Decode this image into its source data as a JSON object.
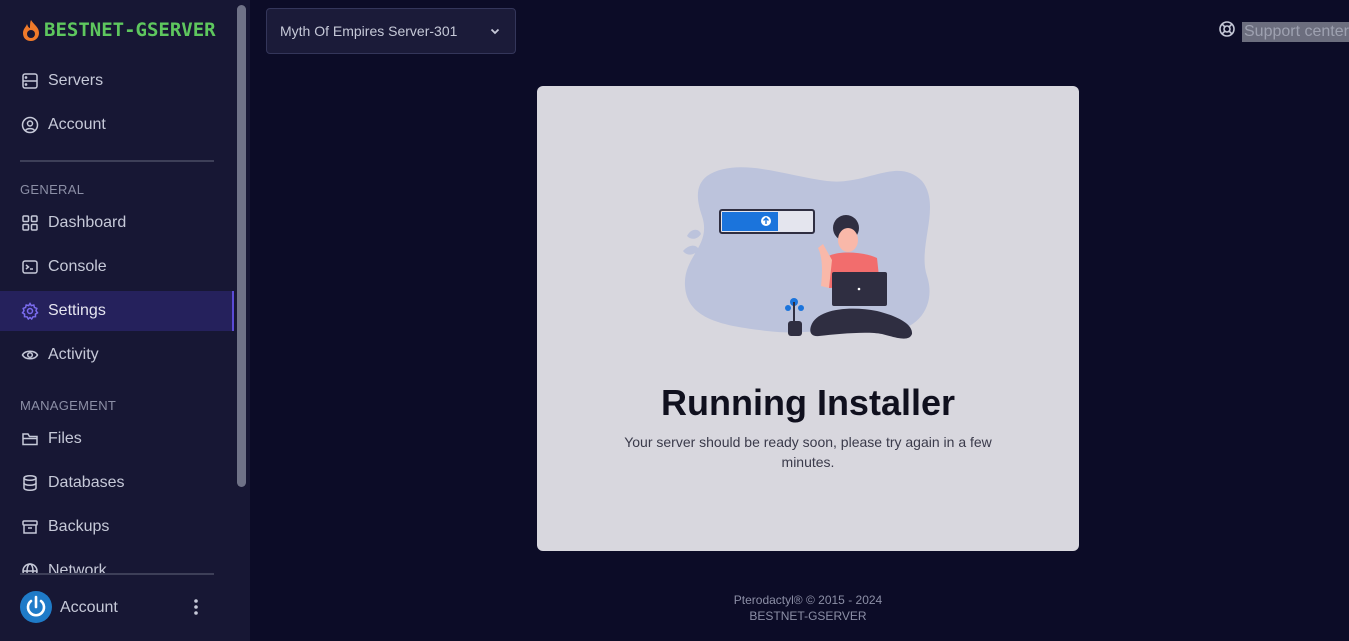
{
  "brand": {
    "name": "BESTNET-GSERVER",
    "color": "#5ec75e"
  },
  "sidebar": {
    "top_items": [
      {
        "label": "Servers",
        "icon": "server-icon"
      },
      {
        "label": "Account",
        "icon": "user-circle-icon"
      }
    ],
    "general_heading": "GENERAL",
    "general_items": [
      {
        "label": "Dashboard",
        "icon": "grid-icon"
      },
      {
        "label": "Console",
        "icon": "terminal-icon"
      },
      {
        "label": "Settings",
        "icon": "gear-icon",
        "active": true
      },
      {
        "label": "Activity",
        "icon": "eye-icon"
      }
    ],
    "management_heading": "MANAGEMENT",
    "management_items": [
      {
        "label": "Files",
        "icon": "folder-icon"
      },
      {
        "label": "Databases",
        "icon": "database-icon"
      },
      {
        "label": "Backups",
        "icon": "archive-icon"
      },
      {
        "label": "Network",
        "icon": "globe-icon"
      }
    ],
    "account_label": "Account"
  },
  "header": {
    "server_select": "Myth Of Empires Server-301",
    "support_label": "Support center"
  },
  "card": {
    "title": "Running Installer",
    "message": "Your server should be ready soon, please try again in a few minutes."
  },
  "footer": {
    "line1": "Pterodactyl® © 2015 - 2024",
    "line2": "BESTNET-GSERVER"
  },
  "colors": {
    "background": "#0c0c27",
    "sidebar": "#171734",
    "active_item": "#25215c",
    "card": "#d8d7de"
  }
}
